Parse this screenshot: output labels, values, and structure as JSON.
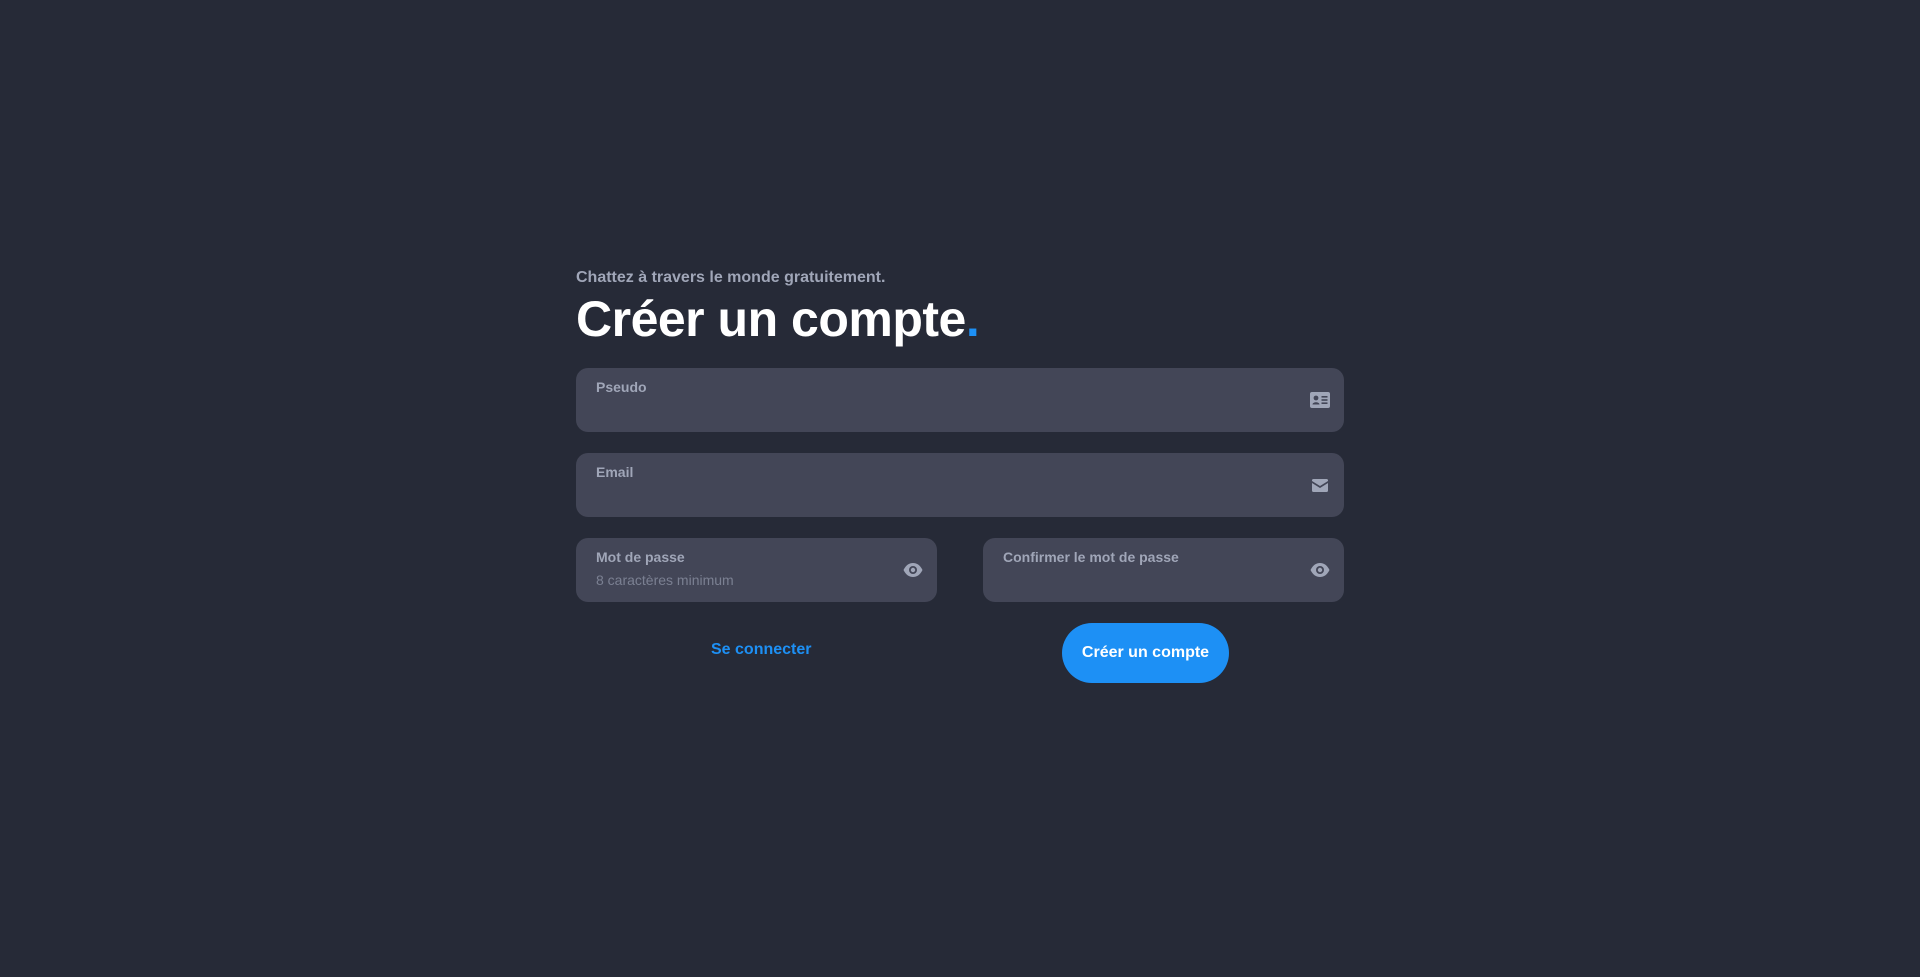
{
  "header": {
    "subtitle": "Chattez à travers le monde gratuitement.",
    "title": "Créer un compte",
    "title_dot": "."
  },
  "form": {
    "pseudo": {
      "label": "Pseudo",
      "placeholder": "",
      "value": "",
      "icon": "id-card-icon"
    },
    "email": {
      "label": "Email",
      "placeholder": "",
      "value": "",
      "icon": "envelope-icon"
    },
    "password": {
      "label": "Mot de passe",
      "placeholder": "8 caractères minimum",
      "value": "",
      "icon": "eye-icon"
    },
    "confirm_password": {
      "label": "Confirmer le mot de passe",
      "placeholder": "",
      "value": "",
      "icon": "eye-icon"
    }
  },
  "actions": {
    "login_label": "Se connecter",
    "submit_label": "Créer un compte"
  },
  "colors": {
    "background": "#262a37",
    "field_bg": "#434657",
    "accent": "#1d90f5",
    "label": "#a0a6b8"
  }
}
